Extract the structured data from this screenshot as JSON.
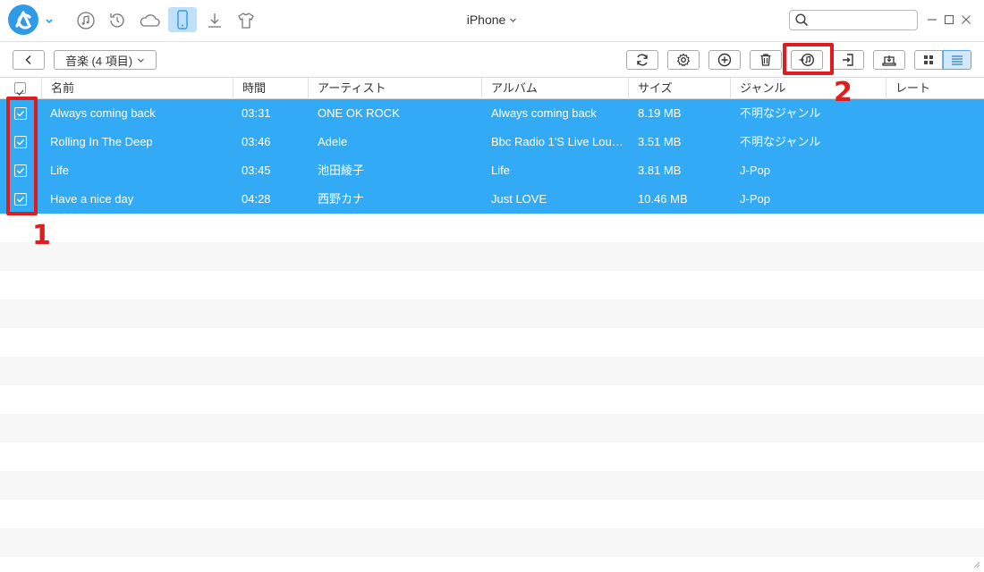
{
  "app": {
    "device_name": "iPhone"
  },
  "search": {
    "placeholder": ""
  },
  "toolbar": {
    "category_label": "音楽 (4 項目)"
  },
  "table": {
    "columns": [
      "名前",
      "時間",
      "アーティスト",
      "アルバム",
      "サイズ",
      "ジャンル",
      "レート"
    ],
    "rows": [
      {
        "name": "Always coming back",
        "time": "03:31",
        "artist": "ONE OK ROCK",
        "album": "Always coming back",
        "size": "8.19 MB",
        "genre": "不明なジャンル",
        "checked": true
      },
      {
        "name": "Rolling In The Deep",
        "time": "03:46",
        "artist": "Adele",
        "album": "Bbc Radio 1'S Live Loung...",
        "size": "3.51 MB",
        "genre": "不明なジャンル",
        "checked": true
      },
      {
        "name": "Life",
        "time": "03:45",
        "artist": "池田綾子",
        "album": "Life",
        "size": "3.81 MB",
        "genre": "J-Pop",
        "checked": true
      },
      {
        "name": "Have a nice day",
        "time": "04:28",
        "artist": "西野カナ",
        "album": "Just LOVE",
        "size": "10.46 MB",
        "genre": "J-Pop",
        "checked": true
      }
    ]
  },
  "annotations": {
    "marker_1": "1",
    "marker_2": "2"
  },
  "colors": {
    "selection": "#33aaf6",
    "accent": "#2f9ae8",
    "highlight": "#e01c1c"
  },
  "icons": {
    "nav": [
      "app-logo-icon",
      "music-icon",
      "history-icon",
      "cloud-icon",
      "phone-icon",
      "download-icon",
      "tshirt-icon"
    ],
    "toolbar": [
      "refresh-icon",
      "settings-icon",
      "add-icon",
      "trash-icon",
      "to-itunes-icon",
      "to-computer-icon",
      "to-device-icon",
      "grid-view-icon",
      "list-view-icon"
    ]
  }
}
